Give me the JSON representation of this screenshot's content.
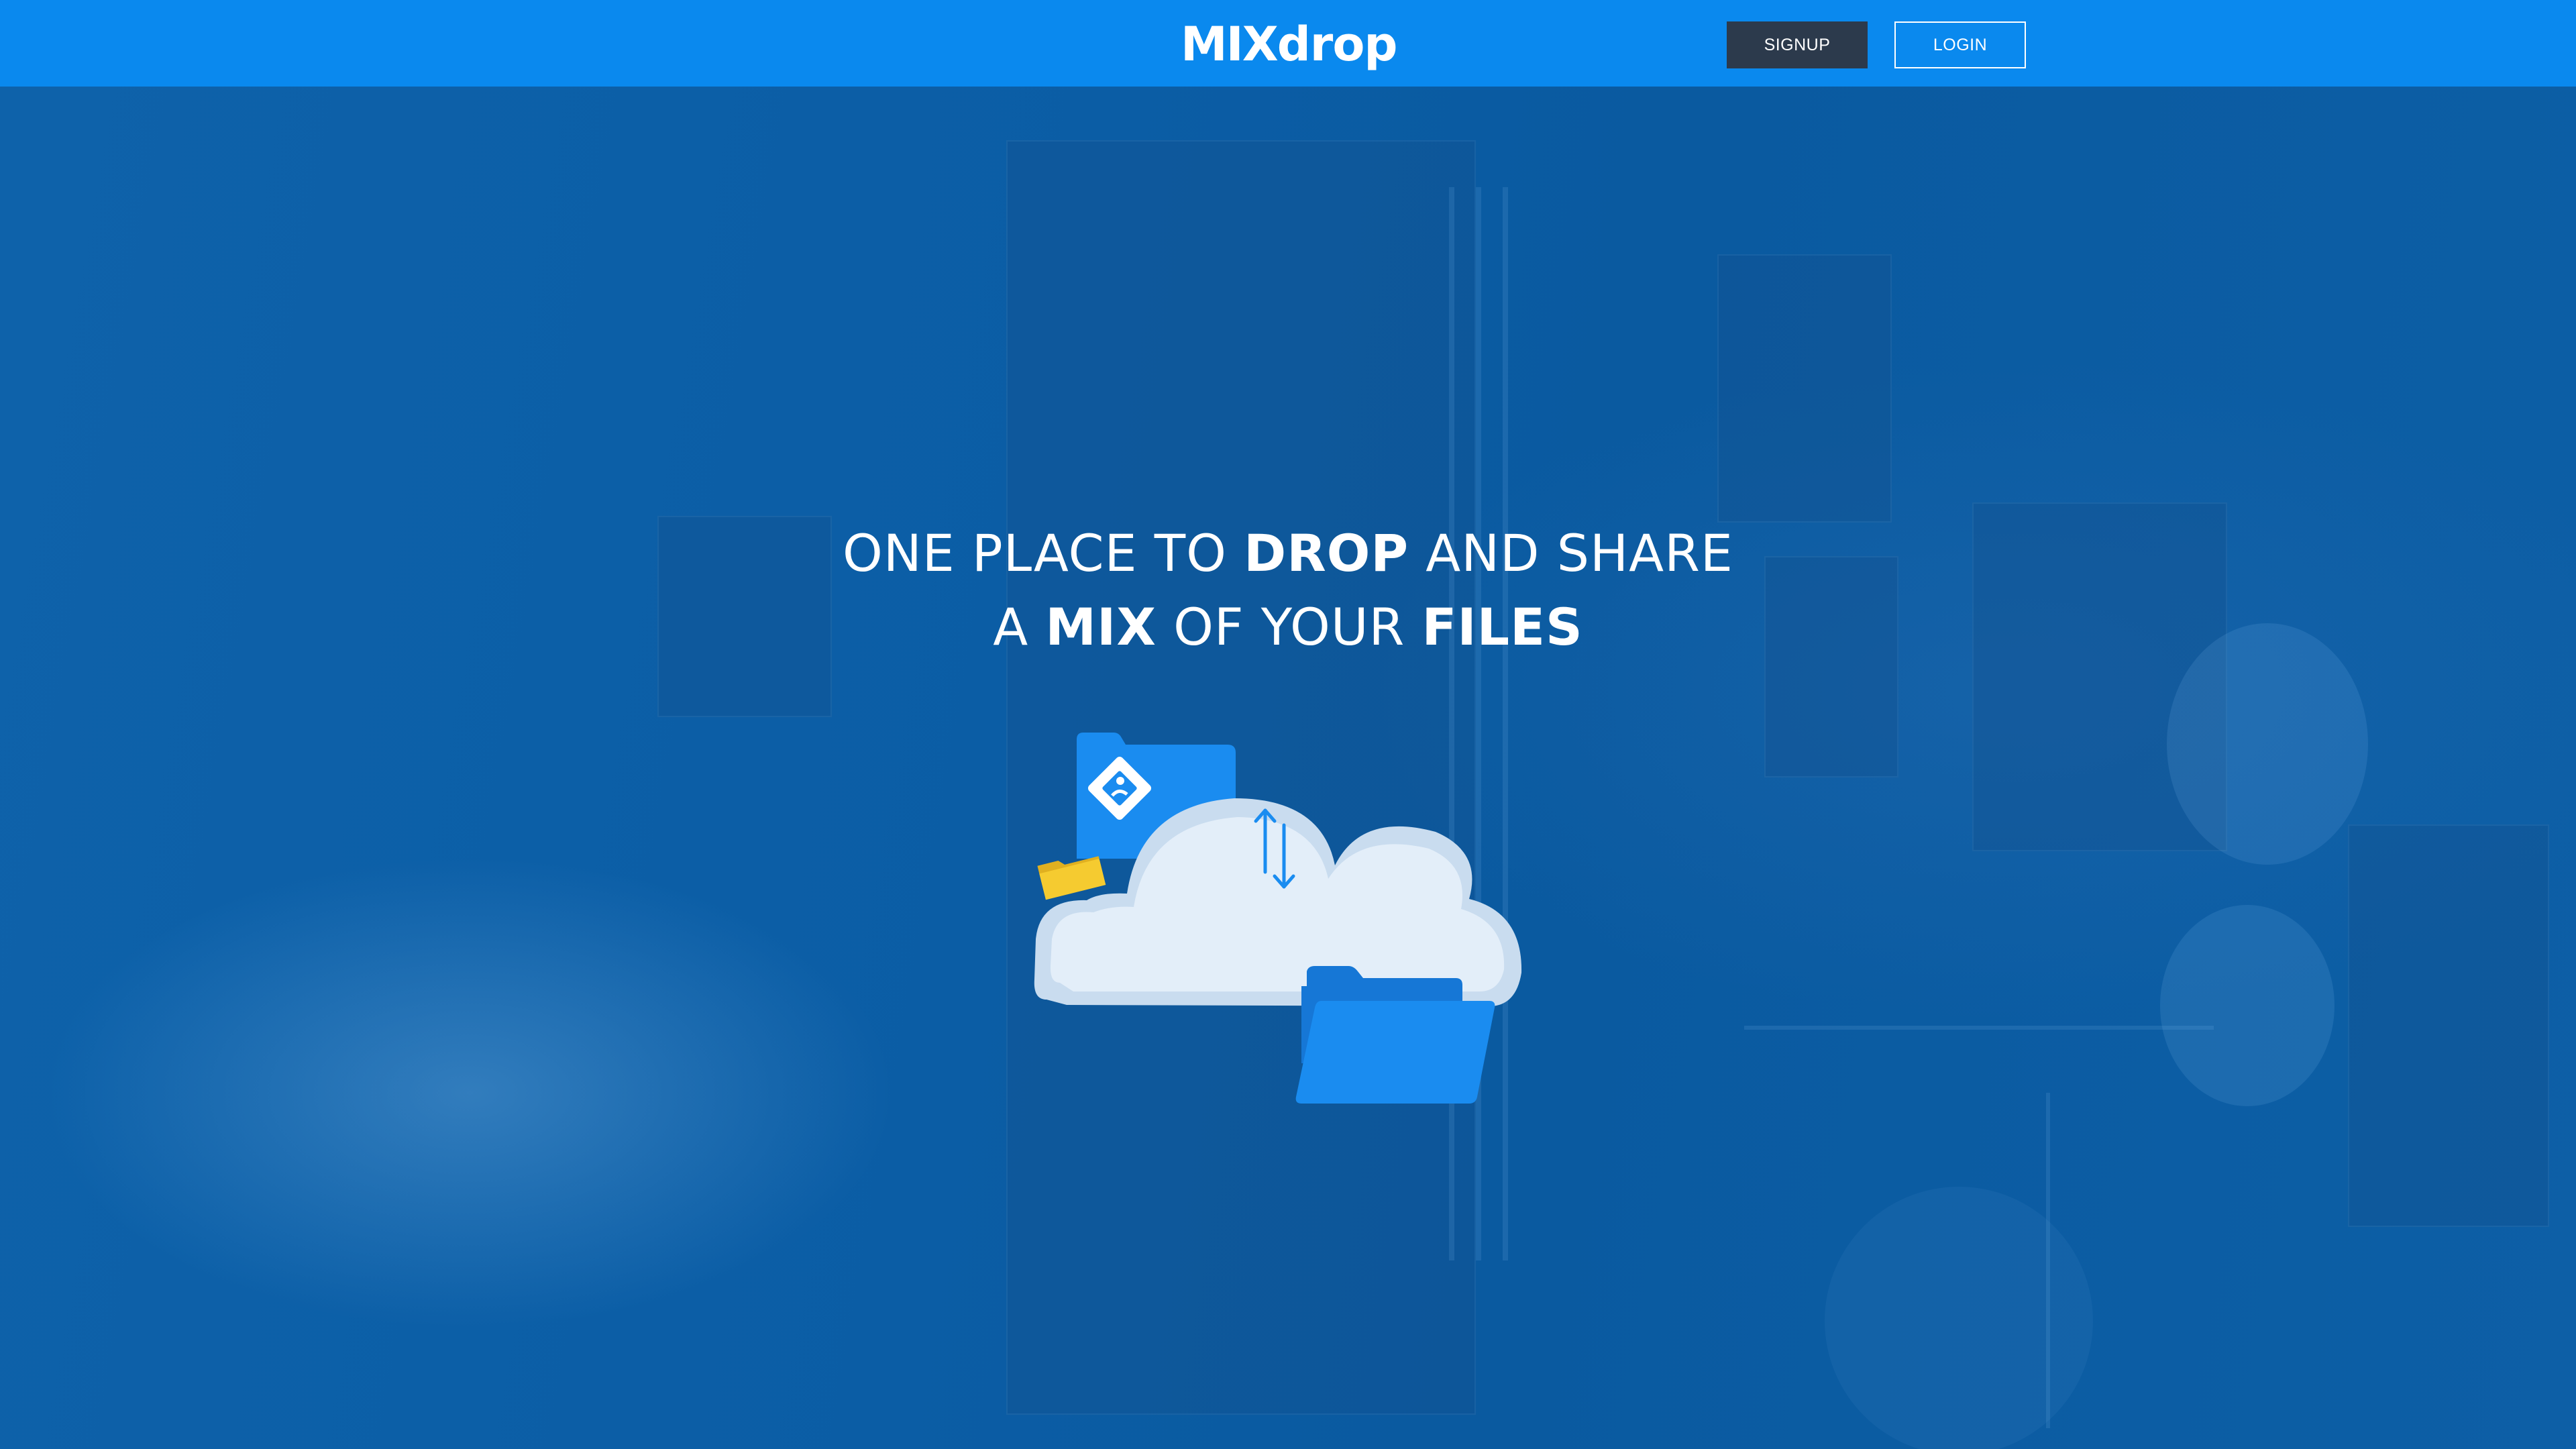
{
  "header": {
    "logo_mix": "MIX",
    "logo_drop": "drop",
    "signup_label": "SIGNUP",
    "login_label": "LOGIN"
  },
  "hero": {
    "line1_a": "ONE PLACE TO ",
    "line1_b": "DROP",
    "line1_c": " AND SHARE",
    "line2_a": "A ",
    "line2_b": "MIX",
    "line2_c": " OF YOUR ",
    "line2_d": "FILES"
  },
  "icons": {
    "cloud": "cloud-icon",
    "transfer": "up-down-arrows-icon",
    "image_folder": "image-folder-icon",
    "yellow_folder": "yellow-folder-icon",
    "open_folder": "open-folder-icon"
  },
  "colors": {
    "header_bg": "#0a89ee",
    "signup_bg": "#2c3a4c",
    "hero_bg": "#0a5fa8",
    "folder_blue": "#1a8cf0",
    "folder_yellow": "#f5cb30",
    "cloud": "#e3eef9"
  }
}
